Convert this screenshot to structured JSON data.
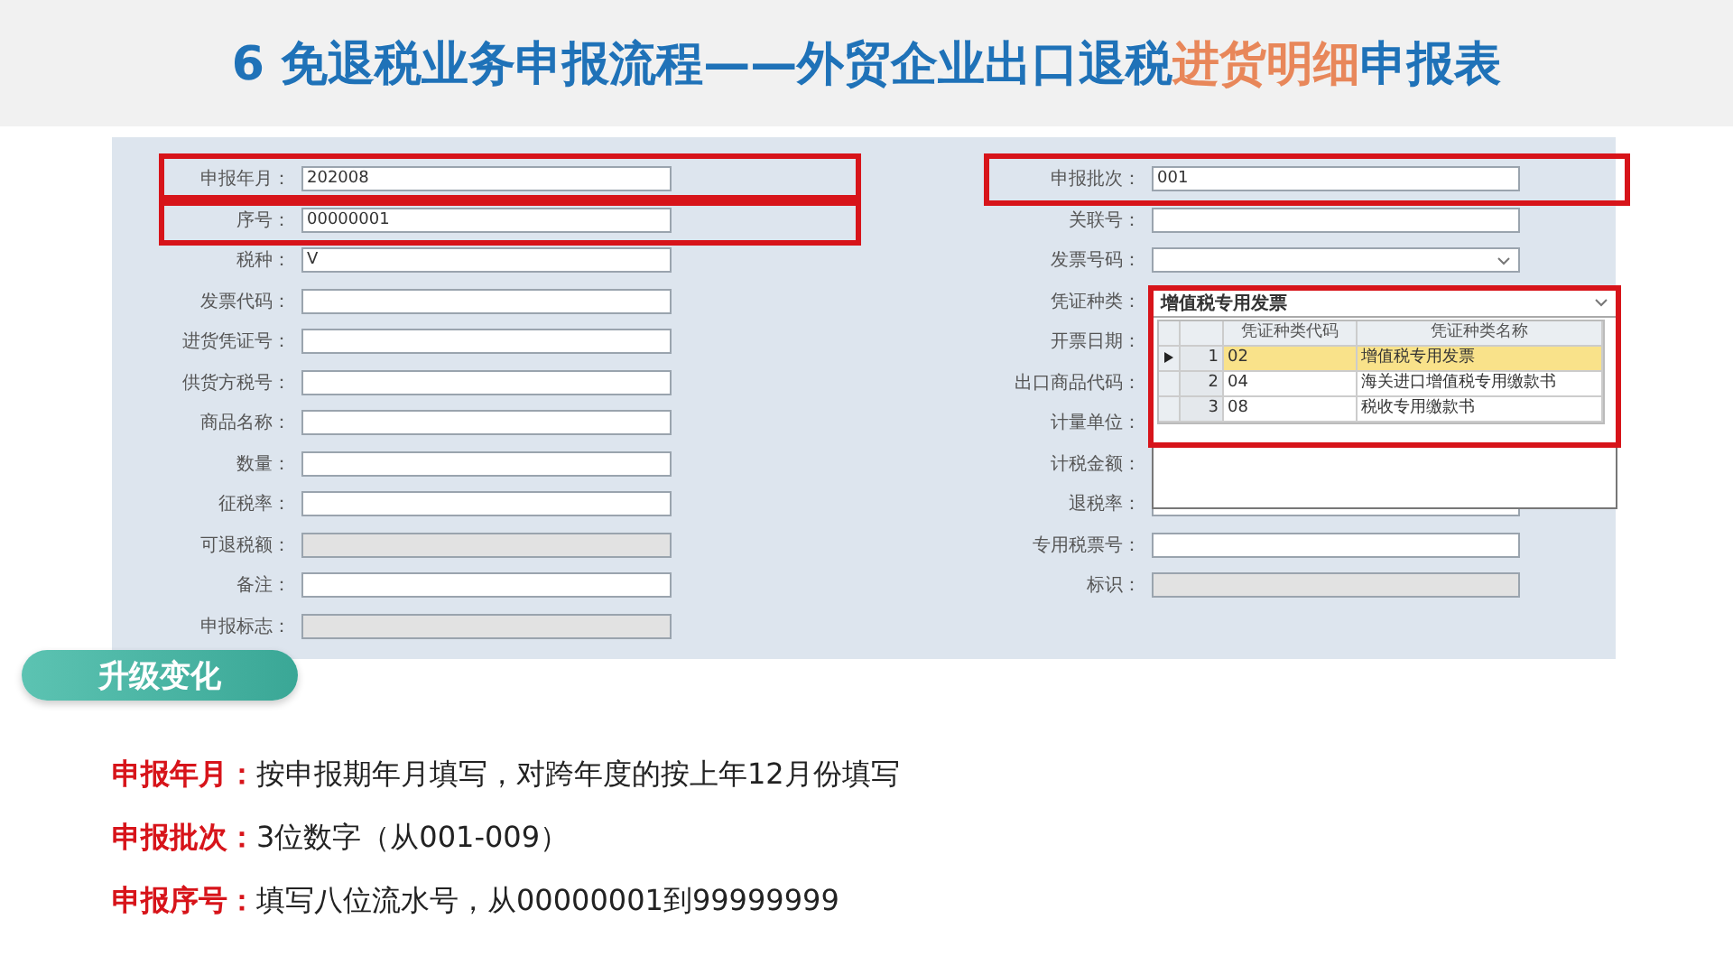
{
  "title": {
    "parts": [
      {
        "text": "6 免退税业务申报流程——外贸企业出口退税",
        "highlight": false
      },
      {
        "text": "进货明细",
        "highlight": true
      },
      {
        "text": "申报表",
        "highlight": false
      }
    ]
  },
  "form": {
    "left_fields": [
      {
        "label": "申报年月：",
        "value": "202008",
        "kind": "text",
        "highlighted": true
      },
      {
        "label": "序号：",
        "value": "00000001",
        "kind": "text",
        "highlighted": true
      },
      {
        "label": "税种：",
        "value": "V",
        "kind": "text",
        "highlighted": false
      },
      {
        "label": "发票代码：",
        "kind": "text",
        "highlighted": false
      },
      {
        "label": "进货凭证号：",
        "kind": "text",
        "highlighted": false
      },
      {
        "label": "供货方税号：",
        "kind": "text",
        "highlighted": false
      },
      {
        "label": "商品名称：",
        "kind": "text",
        "highlighted": false
      },
      {
        "label": "数量：",
        "kind": "text",
        "highlighted": false
      },
      {
        "label": "征税率：",
        "kind": "text",
        "highlighted": false
      },
      {
        "label": "可退税额：",
        "kind": "readonly",
        "highlighted": false
      },
      {
        "label": "备注：",
        "kind": "text",
        "highlighted": false
      },
      {
        "label": "申报标志：",
        "kind": "readonly",
        "highlighted": false
      }
    ],
    "right_fields": [
      {
        "label": "申报批次：",
        "value": "001",
        "kind": "text",
        "highlighted": true
      },
      {
        "label": "关联号：",
        "kind": "text",
        "highlighted": false
      },
      {
        "label": "发票号码：",
        "kind": "select",
        "highlighted": false
      },
      {
        "label": "凭证种类：",
        "kind": "dropdown",
        "highlighted": false
      },
      {
        "label": "开票日期：",
        "kind": "covered",
        "highlighted": false
      },
      {
        "label": "出口商品代码：",
        "kind": "covered",
        "highlighted": false
      },
      {
        "label": "计量单位：",
        "kind": "covered",
        "highlighted": false
      },
      {
        "label": "计税金额：",
        "kind": "covered",
        "highlighted": false
      },
      {
        "label": "退税率：",
        "kind": "text",
        "highlighted": false
      },
      {
        "label": "专用税票号：",
        "kind": "text",
        "highlighted": false
      },
      {
        "label": "标识：",
        "kind": "readonly",
        "highlighted": false
      }
    ],
    "voucher_dropdown": {
      "value": "增值税专用发票",
      "highlighted": true,
      "columns": [
        "凭证种类代码",
        "凭证种类名称"
      ],
      "rows": [
        {
          "index": "1",
          "code": "02",
          "name": "增值税专用发票",
          "selected": true
        },
        {
          "index": "2",
          "code": "04",
          "name": "海关进口增值税专用缴款书",
          "selected": false
        },
        {
          "index": "3",
          "code": "08",
          "name": "税收专用缴款书",
          "selected": false
        }
      ]
    }
  },
  "badge": "升级变化",
  "notes": [
    {
      "label": "申报年月：",
      "text": "按申报期年月填写，对跨年度的按上年12月份填写"
    },
    {
      "label": "申报批次：",
      "text": "3位数字（从001-009）"
    },
    {
      "label": "申报序号：",
      "text": "填写八位流水号，从00000001到99999999"
    }
  ]
}
